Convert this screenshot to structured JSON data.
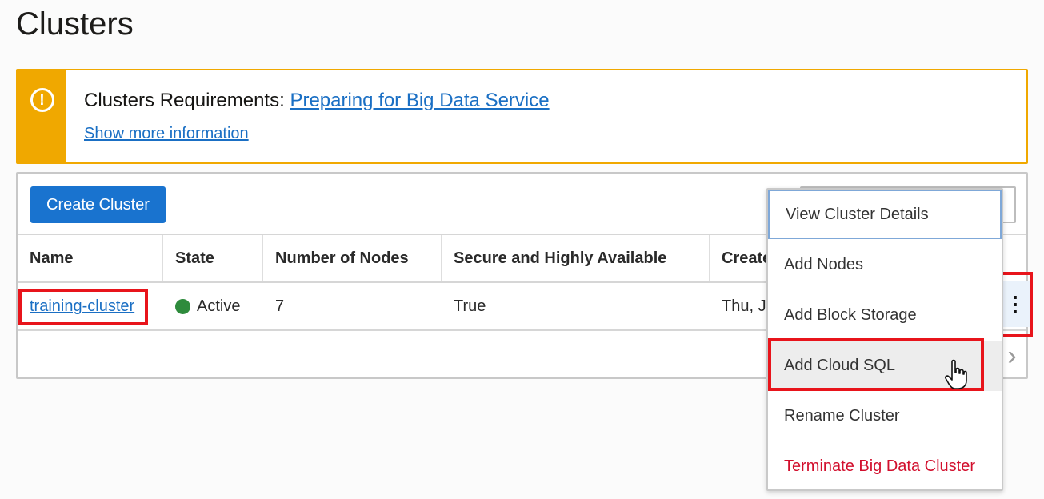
{
  "page": {
    "title": "Clusters"
  },
  "notice": {
    "prefix": "Clusters Requirements: ",
    "link_text": "Preparing for Big Data Service",
    "more_link": "Show more information",
    "icon": "warning-circle-icon",
    "accent_color": "#f0a800"
  },
  "toolbar": {
    "create_label": "Create Cluster"
  },
  "table": {
    "columns": [
      "Name",
      "State",
      "Number of Nodes",
      "Secure and Highly Available",
      "Create"
    ],
    "rows": [
      {
        "name": "training-cluster",
        "state": "Active",
        "nodes": "7",
        "secure": "True",
        "created": "Thu, J"
      }
    ]
  },
  "row_actions": {
    "icon": "kebab-menu-icon",
    "glyph": "⋮"
  },
  "pager": {
    "next_glyph": "›"
  },
  "menu": {
    "items": [
      {
        "label": "View Cluster Details"
      },
      {
        "label": "Add Nodes"
      },
      {
        "label": "Add Block Storage"
      },
      {
        "label": "Add Cloud SQL"
      },
      {
        "label": "Rename Cluster"
      },
      {
        "label": "Terminate Big Data Cluster"
      }
    ]
  },
  "colors": {
    "primary": "#1973cf",
    "link": "#1a6fc4",
    "danger": "#d20f2d",
    "active": "#2e8b3c",
    "highlight": "#e8141b"
  }
}
